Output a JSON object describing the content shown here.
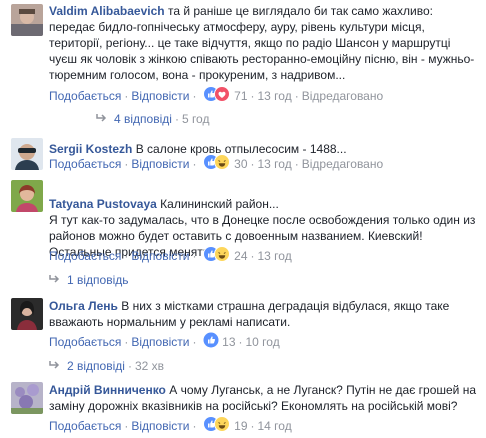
{
  "comments": [
    {
      "author": "Valdim Alibabaevich",
      "text": "та й раніше це виглядало би так само жахливо: передає бидло-гопнічеську атмосферу, ауру, рівень культури місця, території, регіону... це таке відчуття, якщо по радіо Шансон у маршрутці чуєш як чоловік з жінкою співають ресторанно-емоційну пісню, він - мужньо-тюремним голосом, вона - прокуреним, з надривом...",
      "like": "Подобається",
      "reply": "Відповісти",
      "count": "71",
      "time": "13 год",
      "edited": "Відредаговано",
      "replies_label": "4 відповіді",
      "replies_time": "5 год"
    },
    {
      "author": "Sergii Kostezh",
      "text": "В салоне кровь отпылесосим - 1488...",
      "like": "Подобається",
      "reply": "Відповісти",
      "count": "30",
      "time": "13 год",
      "edited": "Відредаговано"
    },
    {
      "author": "Tatyana Pustovaya",
      "text": "Калининский район...\nЯ тут как-то задумалась, что в Донецке после освобождения только один из районов можно будет оставить с довоенным названием. Киевский!\nОстальные придется менять!",
      "like": "Подобається",
      "reply": "Відповісти",
      "count": "24",
      "time": "13 год",
      "replies_label": "1 відповідь"
    },
    {
      "author": "Ольга Лень",
      "text": "В них з містками страшна деградація відбулася, якщо таке вважають нормальним у рекламі написати.",
      "like": "Подобається",
      "reply": "Відповісти",
      "count": "13",
      "time": "10 год",
      "replies_label": "2 відповіді",
      "replies_time": "32 хв"
    },
    {
      "author": "Андрій Винниченко",
      "text": "А чому Луганськ, а не Луганск? Путін не дає грошей на заміну дорожніх вказівників на російські? Економлять на російській мові?",
      "like": "Подобається",
      "reply": "Відповісти",
      "count": "19",
      "time": "14 год"
    }
  ],
  "colors": {
    "link": "#4267b2",
    "author": "#365899",
    "muted": "#90949c",
    "text": "#1d2129",
    "like_blue": "#5890ff",
    "love_red": "#f25268",
    "haha_yellow": "#fdd65b"
  }
}
